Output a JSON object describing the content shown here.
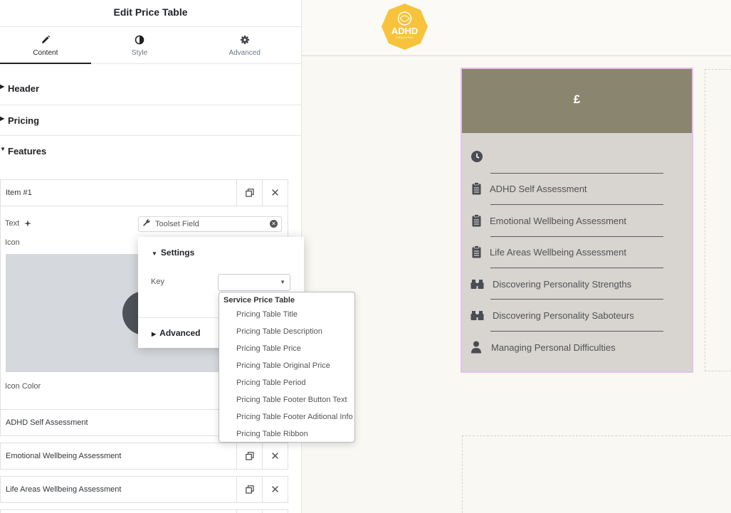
{
  "panel": {
    "title": "Edit Price Table",
    "tabs": [
      {
        "label": "Content",
        "icon": "pencil-icon",
        "active": true
      },
      {
        "label": "Style",
        "icon": "contrast-icon",
        "active": false
      },
      {
        "label": "Advanced",
        "icon": "gear-icon",
        "active": false
      }
    ],
    "sections": [
      {
        "label": "Header",
        "expanded": false
      },
      {
        "label": "Pricing",
        "expanded": false
      },
      {
        "label": "Features",
        "expanded": true
      }
    ],
    "features": {
      "item1": {
        "label": "Item #1",
        "text_label": "Text",
        "dynamic_field": "Toolset Field",
        "icon_label": "Icon",
        "icon_color_label": "Icon Color"
      },
      "items": [
        {
          "label": "ADHD Self Assessment"
        },
        {
          "label": "Emotional Wellbeing Assessment"
        },
        {
          "label": "Life Areas Wellbeing Assessment"
        }
      ]
    }
  },
  "popover": {
    "settings_label": "Settings",
    "key_label": "Key",
    "key_value": "",
    "advanced_label": "Advanced",
    "dropdown": {
      "group": "Service Price Table",
      "options": [
        "Pricing Table Title",
        "Pricing Table Description",
        "Pricing Table Price",
        "Pricing Table Original Price",
        "Pricing Table Period",
        "Pricing Table Footer Button Text",
        "Pricing Table Footer Aditional Info",
        "Pricing Table Ribbon"
      ]
    }
  },
  "preview": {
    "logo": {
      "text": "ADHD",
      "sub": "COACHING",
      "color": "#f7c33c"
    },
    "price_table": {
      "currency": "£",
      "header_color": "#8a856e",
      "body_color": "#d8d4cf",
      "features": [
        {
          "icon": "clock-icon",
          "text": ""
        },
        {
          "icon": "clipboard-icon",
          "text": "ADHD Self Assessment"
        },
        {
          "icon": "clipboard-icon",
          "text": "Emotional Wellbeing Assessment"
        },
        {
          "icon": "clipboard-icon",
          "text": "Life Areas Wellbeing Assessment"
        },
        {
          "icon": "binoculars-icon",
          "text": "Discovering Personality Strengths"
        },
        {
          "icon": "binoculars-icon",
          "text": "Discovering Personality Saboteurs"
        },
        {
          "icon": "user-icon",
          "text": "Managing Personal Difficulties"
        }
      ]
    }
  }
}
